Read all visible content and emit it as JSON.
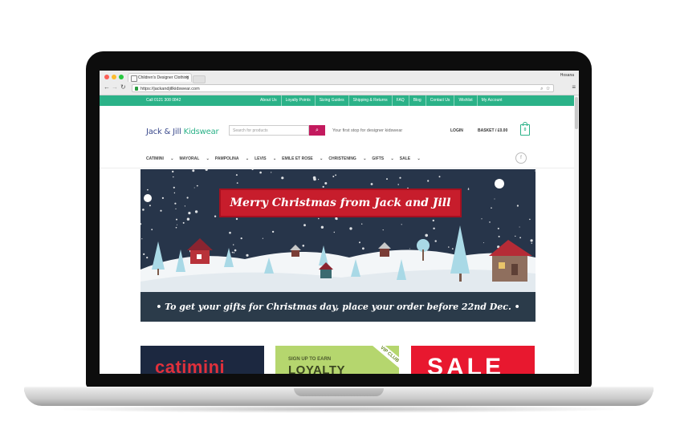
{
  "browser": {
    "tab_title": "Children's Designer Clothing",
    "close": "×",
    "user": "Hosana",
    "url": "https://jackandjillkidswear.com",
    "colors": {
      "close": "#fc5f57",
      "min": "#fdbc2e",
      "max": "#28c840"
    }
  },
  "topbar": {
    "phone": "Call 0121 308 0842",
    "links": [
      "About Us",
      "Loyalty Points",
      "Sizing Guides",
      "Shipping & Returns",
      "FAQ",
      "Blog",
      "Contact Us",
      "Wishlist",
      "My Account"
    ],
    "color": "#2bb288"
  },
  "header": {
    "logo_main": "Jack & Jill ",
    "logo_accent": "Kidswear",
    "search_placeholder": "Search for products",
    "tagline": "Your first stop for designer kidswear",
    "login": "LOGIN",
    "basket": "BASKET / £0.00",
    "basket_count": "0"
  },
  "nav": {
    "items": [
      "CATIMINI",
      "MAYORAL",
      "PAMPOLINA",
      "LEVIS",
      "EMILE ET ROSE",
      "CHRISTENING",
      "GIFTS",
      "SALE"
    ],
    "facebook": "f"
  },
  "banner": {
    "title": "Merry Christmas from Jack and Jill",
    "notice": "• To get your gifts for Christmas day, place your order before 22nd Dec. •"
  },
  "promos": {
    "catimini": "catimini",
    "loyalty_small": "SIGN UP TO EARN",
    "loyalty_big": "LOYALTY",
    "vip": "VIP CLUB",
    "sale": "SALE"
  }
}
